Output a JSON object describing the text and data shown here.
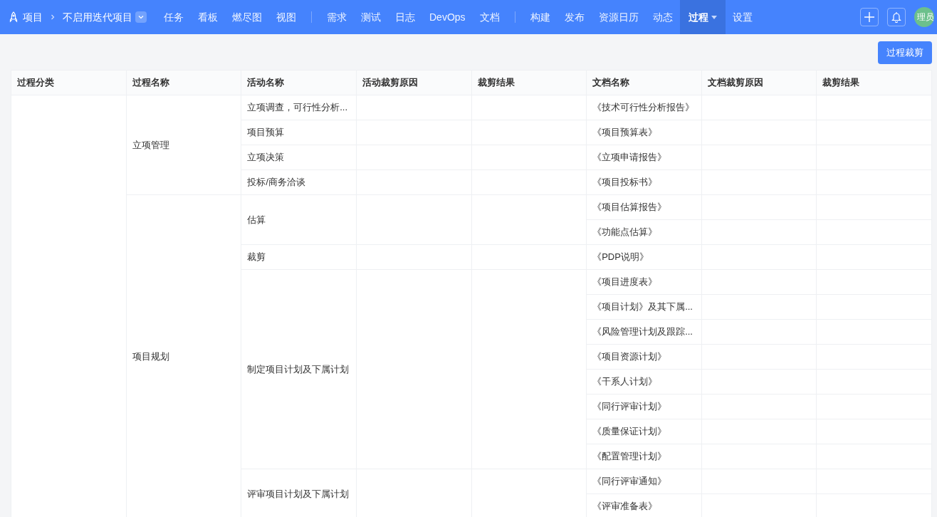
{
  "breadcrumb": {
    "root": "项目",
    "project": "不启用迭代项目"
  },
  "nav_groups": [
    [
      {
        "label": "任务",
        "selected": false,
        "dropdown": false
      },
      {
        "label": "看板",
        "selected": false,
        "dropdown": false
      },
      {
        "label": "燃尽图",
        "selected": false,
        "dropdown": false
      },
      {
        "label": "视图",
        "selected": false,
        "dropdown": false
      }
    ],
    [
      {
        "label": "需求",
        "selected": false,
        "dropdown": false
      },
      {
        "label": "测试",
        "selected": false,
        "dropdown": false
      },
      {
        "label": "日志",
        "selected": false,
        "dropdown": false
      },
      {
        "label": "DevOps",
        "selected": false,
        "dropdown": false
      },
      {
        "label": "文档",
        "selected": false,
        "dropdown": false
      }
    ],
    [
      {
        "label": "构建",
        "selected": false,
        "dropdown": false
      },
      {
        "label": "发布",
        "selected": false,
        "dropdown": false
      },
      {
        "label": "资源日历",
        "selected": false,
        "dropdown": false
      },
      {
        "label": "动态",
        "selected": false,
        "dropdown": false
      },
      {
        "label": "过程",
        "selected": true,
        "dropdown": true
      },
      {
        "label": "设置",
        "selected": false,
        "dropdown": false
      }
    ]
  ],
  "user": {
    "avatar": "理员"
  },
  "action_button": "过程裁剪",
  "table": {
    "columns": [
      "过程分类",
      "过程名称",
      "活动名称",
      "活动裁剪原因",
      "裁剪结果",
      "文档名称",
      "文档裁剪原因",
      "裁剪结果"
    ],
    "processes": [
      {
        "name": "立项管理",
        "activities": [
          {
            "name": "立项调查，可行性分析...",
            "documents": [
              "《技术可行性分析报告》"
            ]
          },
          {
            "name": "项目预算",
            "documents": [
              "《项目预算表》"
            ]
          },
          {
            "name": "立项决策",
            "documents": [
              "《立项申请报告》"
            ]
          },
          {
            "name": "投标/商务洽谈",
            "documents": [
              "《项目投标书》"
            ]
          }
        ]
      },
      {
        "name": "项目规划",
        "activities": [
          {
            "name": "估算",
            "documents": [
              "《项目估算报告》",
              "《功能点估算》"
            ]
          },
          {
            "name": "裁剪",
            "documents": [
              "《PDP说明》"
            ]
          },
          {
            "name": "制定项目计划及下属计划",
            "documents": [
              "《项目进度表》",
              "《项目计划》及其下属...",
              "《风险管理计划及跟踪...",
              "《项目资源计划》",
              "《干系人计划》",
              "《同行评审计划》",
              "《质量保证计划》",
              "《配置管理计划》"
            ]
          },
          {
            "name": "评审项目计划及下属计划",
            "documents": [
              "《同行评审通知》",
              "《评审准备表》"
            ]
          }
        ]
      }
    ]
  }
}
